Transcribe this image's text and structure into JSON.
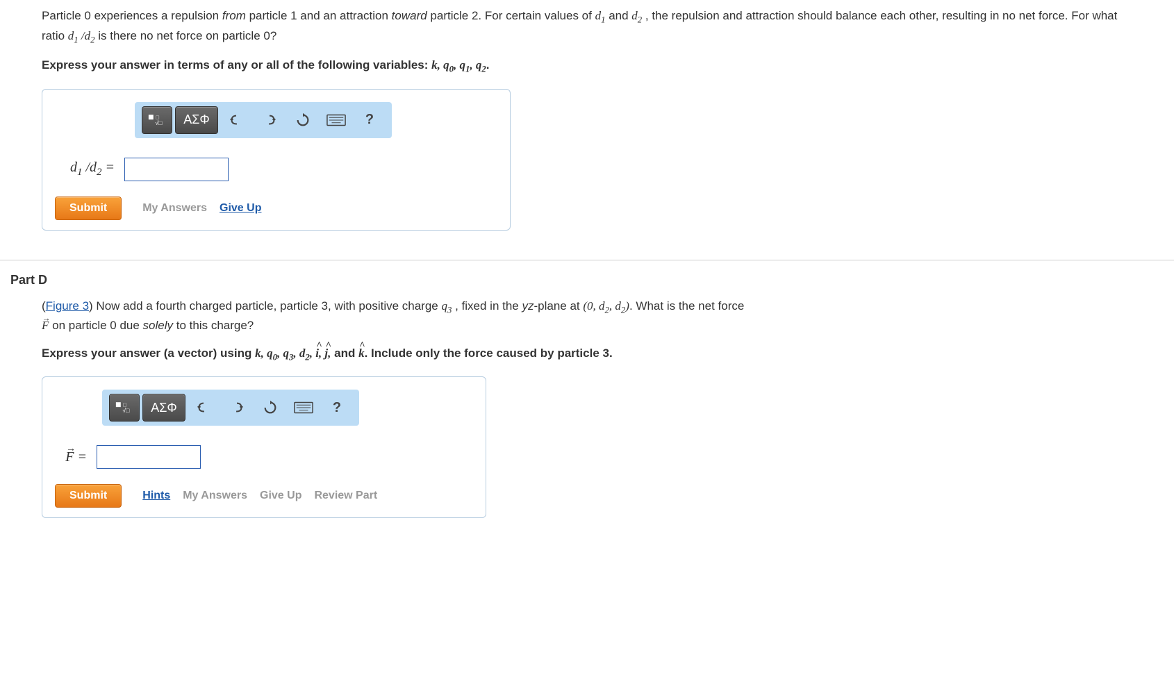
{
  "partC": {
    "text_prefix": "Particle 0 experiences a repulsion ",
    "text_from": "from",
    "text_mid1": " particle 1 and an attraction ",
    "text_toward": "toward",
    "text_mid2": " particle 2. For certain values of ",
    "var_d1": "d",
    "var_d1_sub": "1",
    "text_and": " and ",
    "var_d2": "d",
    "var_d2_sub": "2",
    "text_after": " , the repulsion and attraction should balance each other, resulting in no net force. For what ratio ",
    "ratio": "d",
    "ratio_sub1": "1",
    "ratio_slash": " /",
    "ratio_d2": "d",
    "ratio_sub2": "2",
    "text_end": " is there no net force on particle 0?",
    "instruction_prefix": "Express your answer in terms of any or all of the following variables: ",
    "vars": "k, q₀, q₁, q₂",
    "punct": ".",
    "answer_label": "d₁ /d₂ =",
    "answer_value": "",
    "submit": "Submit",
    "my_answers": "My Answers",
    "give_up": "Give Up"
  },
  "partD": {
    "header": "Part D",
    "figure_link": "Figure 3",
    "text1": ") Now add a fourth charged particle, particle 3, with positive charge ",
    "q3": "q",
    "q3_sub": "3",
    "text2": " , fixed in the ",
    "yz": "yz",
    "text3": "-plane at ",
    "coord": "(0,  d₂ ,  d₂ )",
    "text4": ". What is the net force ",
    "F": "F",
    "text5": " on particle 0 due ",
    "solely": "solely",
    "text6": " to this charge?",
    "instruction_prefix": "Express your answer (a vector) using ",
    "vars": "k, q₀, q₃, d₂, î, ĵ,",
    "and": " and ",
    "khat": "k̂",
    "instruction_suffix": ". Include only the force caused by particle 3.",
    "answer_label": "F⃗  =",
    "answer_value": "",
    "submit": "Submit",
    "hints": "Hints",
    "my_answers": "My Answers",
    "give_up": "Give Up",
    "review": "Review Part"
  },
  "toolbar": {
    "greek": "ΑΣΦ",
    "help": "?"
  }
}
